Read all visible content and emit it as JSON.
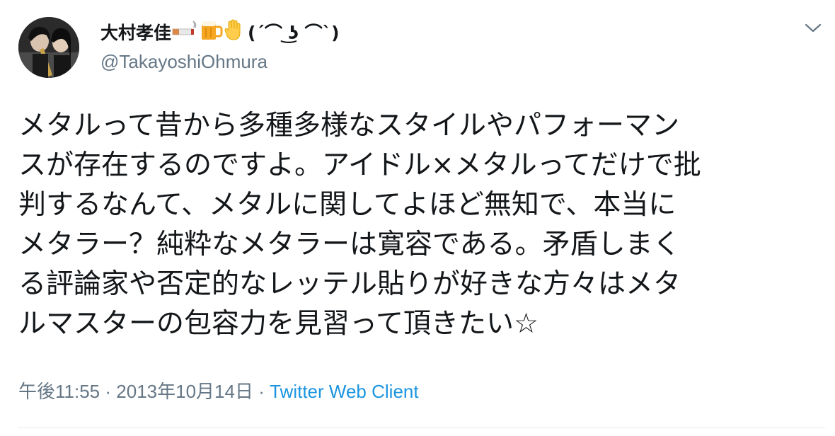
{
  "author": {
    "display_name": "大村孝佳",
    "name_suffix": "(´⌒ ͜ʖ ⌒`)",
    "emoji_icons": [
      "cigarette-icon",
      "beer-mug-icon",
      "raised-hand-icon"
    ],
    "handle": "@TakayoshiOhmura"
  },
  "tweet": {
    "lines": [
      "メタルって昔から多種多様なスタイルやパフォーマン",
      "スが存在するのですよ。アイドル×メタルってだけで批",
      "判するなんて、メタルに関してよほど無知で、本当に",
      "メタラー？純粋なメタラーは寛容である。矛盾しまく",
      "る評論家や否定的なレッテル貼りが好きな方々はメタ",
      "ルマスターの包容力を見習って頂きたい☆"
    ]
  },
  "meta": {
    "time": "午後11:55",
    "separator": "·",
    "date": "2013年10月14日",
    "client": "Twitter Web Client"
  },
  "colors": {
    "text": "#14171a",
    "secondary": "#657786",
    "link": "#1b95e0",
    "divider": "#e6ecf0"
  }
}
